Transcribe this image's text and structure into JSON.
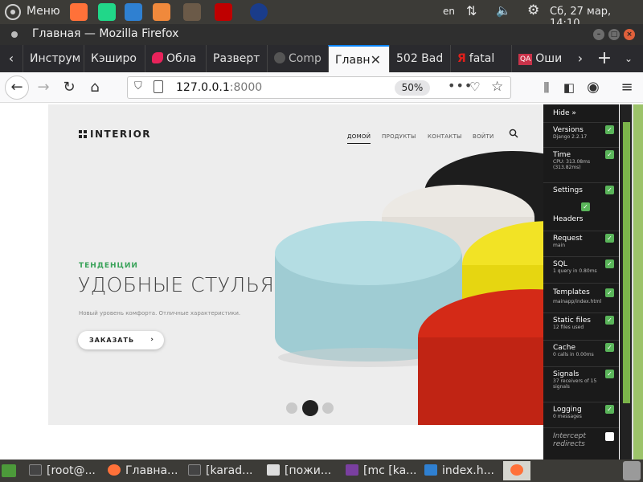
{
  "system": {
    "menu_label": "Меню",
    "lang": "en",
    "clock": "Сб, 27 мар, 14:10",
    "apps": [
      {
        "name": "firefox-icon",
        "color": "#ff7139"
      },
      {
        "name": "pycharm-icon",
        "color": "#21d789"
      },
      {
        "name": "vscode-icon",
        "color": "#2f80d1"
      },
      {
        "name": "sublime-icon",
        "color": "#f0893c"
      },
      {
        "name": "gimp-icon",
        "color": "#6b5a48"
      },
      {
        "name": "filezilla-icon",
        "color": "#bf0000"
      },
      {
        "name": "mc-icon",
        "color": "#1a3c8a"
      }
    ]
  },
  "window": {
    "title": "Главная — Mozilla Firefox",
    "btn_min": "–",
    "btn_max": "□",
    "btn_close": "×"
  },
  "tabs": [
    {
      "label": "Инструм",
      "icon_color": "#888"
    },
    {
      "label": "Кэширо",
      "icon_color": "#888"
    },
    {
      "label": "Обла",
      "icon_color": "#e8235b"
    },
    {
      "label": "Разверт",
      "icon_color": "#888"
    },
    {
      "label": "Comp",
      "icon_color": "#444"
    },
    {
      "label": "Главн",
      "icon_color": "#888",
      "active": true
    },
    {
      "label": "502 Bad",
      "icon_color": "#888"
    },
    {
      "label": "fatal",
      "icon_color": "#e0201b"
    },
    {
      "label": "Оши",
      "icon_color": "#c9334a"
    }
  ],
  "tab_icon_labels": {
    "yandex": "Я",
    "qa": "QA"
  },
  "nav": {
    "url_host": "127.0.0.1",
    "url_port": ":8000",
    "zoom": "50%",
    "dots": "•••"
  },
  "site": {
    "logo": "INTERIOR",
    "menu": [
      {
        "label": "ДОМОЙ",
        "active": true
      },
      {
        "label": "ПРОДУКТЫ"
      },
      {
        "label": "КОНТАКТЫ"
      },
      {
        "label": "ВОЙТИ"
      }
    ],
    "kicker": "ТЕНДЕНЦИИ",
    "headline": "УДОБНЫЕ СТУЛЬЯ",
    "subtitle": "Новый уровень комфорта. Отличные характеристики.",
    "cta": "ЗАКАЗАТЬ",
    "cta_arrow": "›",
    "slides": 3,
    "active_slide": 2
  },
  "debug_toolbar": {
    "hide": "Hide »",
    "panels": [
      {
        "label": "Versions",
        "sub": "Django 2.2.17",
        "checked": true
      },
      {
        "label": "Time",
        "sub": "CPU: 313.08ms",
        "sub2": "(313.82ms)",
        "checked": true
      },
      {
        "label": "Settings",
        "sub": "",
        "checked": true
      },
      {
        "label": "Headers",
        "sub": "",
        "checked": true
      },
      {
        "label": "Request",
        "sub": "main",
        "checked": true
      },
      {
        "label": "SQL",
        "sub": "1 query in 0.80ms",
        "checked": true
      },
      {
        "label": "Templates",
        "sub": "mainapp/index.html",
        "checked": true
      },
      {
        "label": "Static files",
        "sub": "12 files used",
        "checked": true
      },
      {
        "label": "Cache",
        "sub": "0 calls in 0.00ms",
        "checked": true
      },
      {
        "label": "Signals",
        "sub": "37 receivers of 15",
        "sub2": "signals",
        "checked": true
      },
      {
        "label": "Logging",
        "sub": "0 messages",
        "checked": true
      },
      {
        "label": "Intercept",
        "sub": "redirects",
        "checked": false,
        "dim": true
      }
    ]
  },
  "taskbar": {
    "items": [
      {
        "label": "[root@...",
        "icon_color": "#555"
      },
      {
        "label": "Главна...",
        "icon_color": "#ff7139"
      },
      {
        "label": "[karad...",
        "icon_color": "#555"
      },
      {
        "label": "[пожи...",
        "icon_color": "#777"
      },
      {
        "label": "[mc [ka...",
        "icon_color": "#7a3fa0"
      },
      {
        "label": "index.h...",
        "icon_color": "#2f80d1"
      }
    ]
  },
  "colors": {
    "accent_green": "#3aa35a",
    "tab_highlight": "#0a84ff",
    "pouf_blue": "#a9d7de",
    "pouf_yellow": "#f2e325",
    "pouf_red": "#d42a17",
    "pouf_white": "#ece9e4",
    "pouf_black": "#1d1d1d"
  }
}
